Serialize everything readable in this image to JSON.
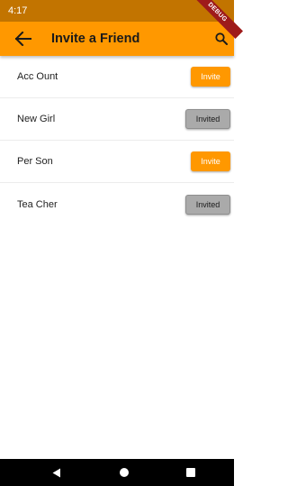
{
  "status_bar": {
    "time": "4:17",
    "debug_label": "DEBUG"
  },
  "app_bar": {
    "title": "Invite a Friend",
    "back_icon": "arrow-left-icon",
    "search_icon": "search-icon"
  },
  "friends": [
    {
      "name": "Acc Ount",
      "button_label": "Invite",
      "status": "invite"
    },
    {
      "name": "New Girl",
      "button_label": "Invited",
      "status": "invited"
    },
    {
      "name": "Per Son",
      "button_label": "Invite",
      "status": "invite"
    },
    {
      "name": "Tea Cher",
      "button_label": "Invited",
      "status": "invited"
    }
  ],
  "nav_bar": {
    "back_icon": "triangle-back-icon",
    "home_icon": "circle-home-icon",
    "recent_icon": "square-recents-icon"
  },
  "colors": {
    "status_bar": "#C27400",
    "app_bar": "#FF9800",
    "invite_button": "#FF9800",
    "invited_button": "#AAAAAA",
    "debug_ribbon": "#9E1B1B"
  }
}
